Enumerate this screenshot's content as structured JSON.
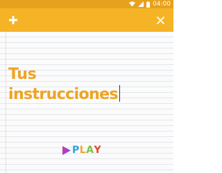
{
  "status_bar": {
    "time": "04:00",
    "icons": [
      "wifi-icon",
      "signal-icon",
      "battery-icon"
    ]
  },
  "app_bar": {
    "add_icon": "plus-icon",
    "close_icon": "close-icon"
  },
  "content": {
    "title_line1": "Tus",
    "title_line2": "instrucciones"
  },
  "play": {
    "icon": "play-triangle-icon",
    "letters": [
      "P",
      "L",
      "A",
      "Y"
    ]
  },
  "colors": {
    "status_bar": "#e6a11f",
    "app_bar": "#f5b326",
    "title": "#f0a321",
    "play_letters": [
      "#2aa4e0",
      "#f5a623",
      "#7cc242",
      "#e6452f"
    ]
  }
}
